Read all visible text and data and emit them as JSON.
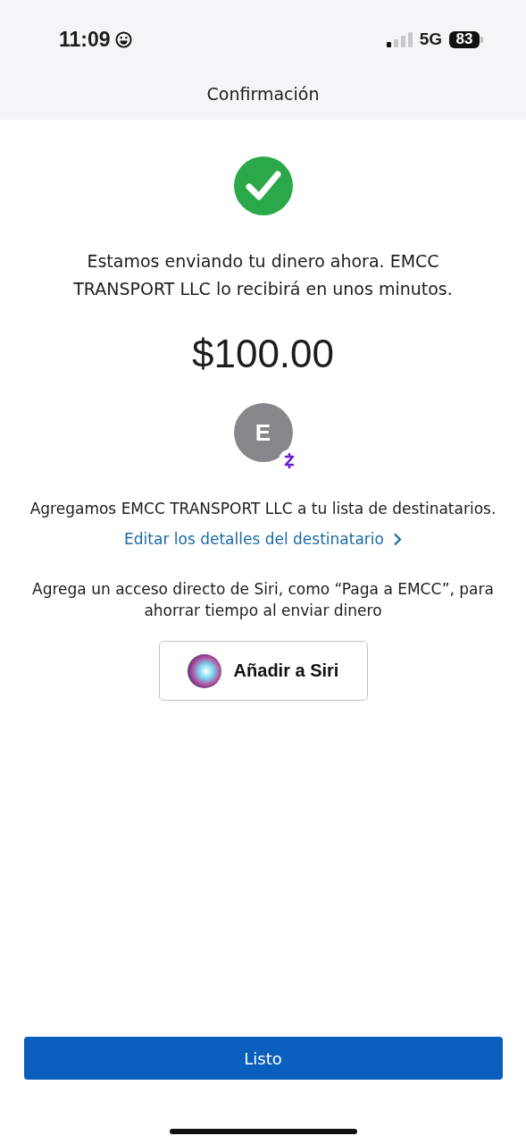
{
  "status_bar": {
    "time": "11:09",
    "network": "5G",
    "battery": "83"
  },
  "header": {
    "title": "Confirmación"
  },
  "message": "Estamos enviando tu dinero ahora. EMCC TRANSPORT LLC lo recibirá en unos minutos.",
  "amount": "$100.00",
  "recipient": {
    "initial": "E"
  },
  "added_note": "Agregamos EMCC TRANSPORT LLC a tu lista de destinatarios.",
  "edit_link": "Editar los detalles del destinatario",
  "siri_note": "Agrega un acceso directo de Siri, como “Paga a EMCC”, para ahorrar tiempo al enviar dinero",
  "siri_button": "Añadir a Siri",
  "done_button": "Listo"
}
